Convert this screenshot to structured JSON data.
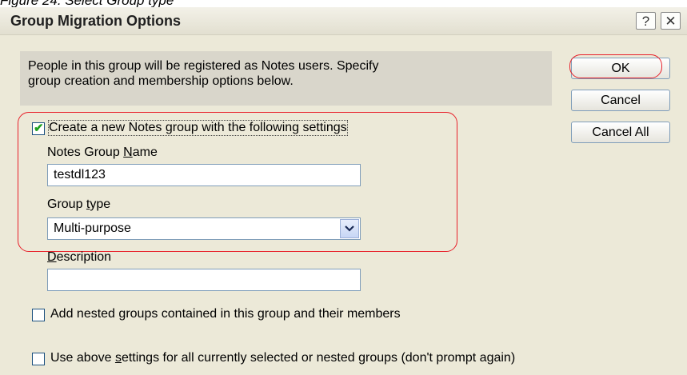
{
  "caption": "Figure 24. Select Group type",
  "window": {
    "title": "Group Migration Options",
    "help_glyph": "?",
    "close_glyph": "✕"
  },
  "info": {
    "line1": "People in this group will be registered as Notes users.  Specify",
    "line2": "group creation and membership options below."
  },
  "buttons": {
    "ok": "OK",
    "cancel": "Cancel",
    "cancel_all": "Cancel All"
  },
  "create_group": {
    "checked": true,
    "label": "Create a new Notes group with the following settings",
    "name_label_a": "Notes Group ",
    "name_label_b": "N",
    "name_label_c": "ame",
    "name_value": "testdl123",
    "type_label_a": "Group ",
    "type_label_b": "t",
    "type_label_c": "ype",
    "type_value": "Multi-purpose",
    "description_label_a": "D",
    "description_label_b": "escription",
    "description_value": ""
  },
  "nested": {
    "checked": false,
    "label_a": "Add nested ",
    "label_b": "g",
    "label_c": "roups contained in this group and their members"
  },
  "apply_all": {
    "checked": false,
    "label_a": "Use above ",
    "label_b": "s",
    "label_c": "ettings for all currently selected or nested groups (don't prompt again)"
  },
  "colors": {
    "dialog_bg": "#ece9d8",
    "annotation": "#e8202a",
    "checkmark": "#21a121"
  }
}
